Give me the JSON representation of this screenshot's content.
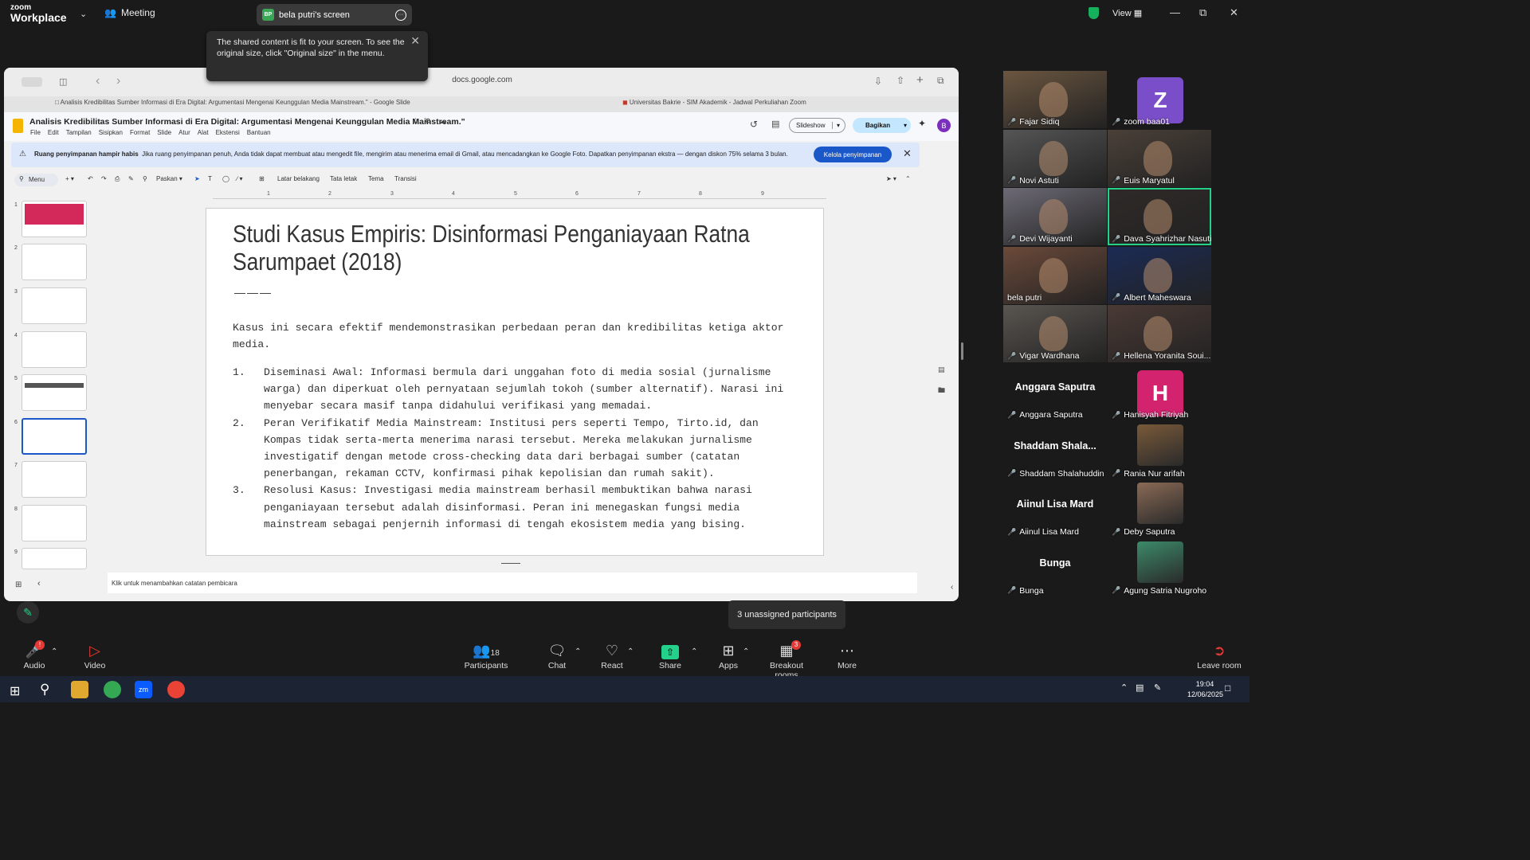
{
  "zoom": {
    "logo_top": "zoom",
    "logo_bottom": "Workplace",
    "meeting_label": "Meeting",
    "share_badge": "BP",
    "share_title": "bela putri's screen",
    "view_label": "View",
    "tooltip_text": "The shared content is fit to your screen. To see the original size, click \"Original size\" in the menu."
  },
  "browser": {
    "url": "docs.google.com",
    "tab1": "Analisis Kredibilitas Sumber Informasi di Era Digital: Argumentasi Mengenai Keunggulan Media Mainstream.\" - Google Slide",
    "tab2": "Universitas Bakrie - SIM Akademik - Jadwal Perkuliahan Zoom"
  },
  "slides_app": {
    "doc_title": "Analisis Kredibilitas Sumber Informasi di Era Digital: Argumentasi Mengenai Keunggulan Media Mainstream.\"",
    "menu": [
      "File",
      "Edit",
      "Tampilan",
      "Sisipkan",
      "Format",
      "Slide",
      "Atur",
      "Alat",
      "Ekstensi",
      "Bantuan"
    ],
    "slideshow_label": "Slideshow",
    "share_label": "Bagikan",
    "avatar_letter": "B",
    "banner_bold": "Ruang penyimpanan hampir habis",
    "banner_text": "Jika ruang penyimpanan penuh, Anda tidak dapat membuat atau mengedit file, mengirim atau menerima email di Gmail, atau mencadangkan ke Google Foto. Dapatkan penyimpanan ekstra — dengan diskon 75% selama 3 bulan.",
    "banner_button": "Kelola penyimpanan",
    "toolbar": {
      "menu": "Menu",
      "zoom": "Paskan",
      "background": "Latar belakang",
      "layout": "Tata letak",
      "theme": "Tema",
      "transition": "Transisi"
    },
    "ruler": [
      "1",
      "2",
      "3",
      "4",
      "5",
      "6",
      "7",
      "8",
      "9"
    ],
    "thumb_numbers": [
      "1",
      "2",
      "3",
      "4",
      "5",
      "6",
      "7",
      "8",
      "9"
    ],
    "notes_placeholder": "Klik untuk menambahkan catatan pembicara"
  },
  "slide": {
    "title": "Studi Kasus Empiris: Disinformasi Penganiayaan Ratna Sarumpaet (2018)",
    "divider": "———",
    "intro": "Kasus ini secara efektif mendemonstrasikan perbedaan peran dan kredibilitas ketiga aktor media.",
    "items": [
      {
        "n": "1.",
        "text": "Diseminasi Awal: Informasi bermula dari unggahan foto di media sosial (jurnalisme warga) dan diperkuat oleh pernyataan sejumlah tokoh (sumber alternatif). Narasi ini menyebar secara masif tanpa didahului verifikasi yang memadai."
      },
      {
        "n": "2.",
        "text": "Peran Verifikatif Media Mainstream: Institusi pers seperti Tempo, Tirto.id, dan Kompas tidak serta-merta menerima narasi tersebut. Mereka melakukan jurnalisme investigatif dengan metode cross-checking data dari berbagai sumber (catatan penerbangan, rekaman CCTV, konfirmasi pihak kepolisian dan rumah sakit)."
      },
      {
        "n": "3.",
        "text": "Resolusi Kasus: Investigasi media mainstream berhasil membuktikan bahwa narasi penganiayaan tersebut adalah disinformasi. Peran ini menegaskan fungsi media mainstream sebagai penjernih informasi di tengah ekosistem media yang bising."
      }
    ]
  },
  "participants": [
    {
      "name": "Fajar Sidiq",
      "kind": "video",
      "color": "#6b5640"
    },
    {
      "name": "zoom baa01",
      "kind": "letter",
      "letter": "Z",
      "color": "#7b4ec9"
    },
    {
      "name": "Novi Astuti",
      "kind": "video",
      "color": "#555555"
    },
    {
      "name": "Euis Maryatul",
      "kind": "video",
      "color": "#4a4038"
    },
    {
      "name": "Devi Wijayanti",
      "kind": "video",
      "color": "#6d6a75"
    },
    {
      "name": "Dava Syahrizhar Nasution",
      "kind": "video",
      "color": "#2f2a28",
      "active": true
    },
    {
      "name": "bela putri",
      "kind": "video",
      "color": "#6b4a3a"
    },
    {
      "name": "Albert Maheswara",
      "kind": "video",
      "color": "#1b2b55"
    },
    {
      "name": "Vigar Wardhana",
      "kind": "video",
      "color": "#5a5550"
    },
    {
      "name": "Hellena Yoranita Soui...",
      "kind": "video",
      "color": "#4a3a35"
    },
    {
      "name": "Anggara Saputra",
      "kind": "text",
      "big": "Anggara Saputra"
    },
    {
      "name": "Hanisyah Fitriyah",
      "kind": "letter",
      "letter": "H",
      "color": "#d3226e"
    },
    {
      "name": "Shaddam Shalahuddin",
      "kind": "text",
      "big": "Shaddam  Shala..."
    },
    {
      "name": "Rania Nur arifah",
      "kind": "photo",
      "color": "#7a5a3a"
    },
    {
      "name": "Aiinul Lisa Mard",
      "kind": "text",
      "big": "Aiinul Lisa Mard"
    },
    {
      "name": "Deby Saputra",
      "kind": "photo",
      "color": "#8a6a55"
    },
    {
      "name": "Bunga",
      "kind": "text",
      "big": "Bunga"
    },
    {
      "name": "Agung Satria Nugroho",
      "kind": "photo",
      "color": "#3c8a6a"
    }
  ],
  "unassigned": "3 unassigned participants",
  "toolbar": {
    "audio": "Audio",
    "video": "Video",
    "participants": "Participants",
    "participants_count": "18",
    "chat": "Chat",
    "react": "React",
    "share": "Share",
    "apps": "Apps",
    "breakout": "Breakout rooms",
    "breakout_badge": "3",
    "more": "More",
    "leave": "Leave room"
  },
  "taskbar": {
    "time": "19:04",
    "date": "12/06/2025"
  }
}
